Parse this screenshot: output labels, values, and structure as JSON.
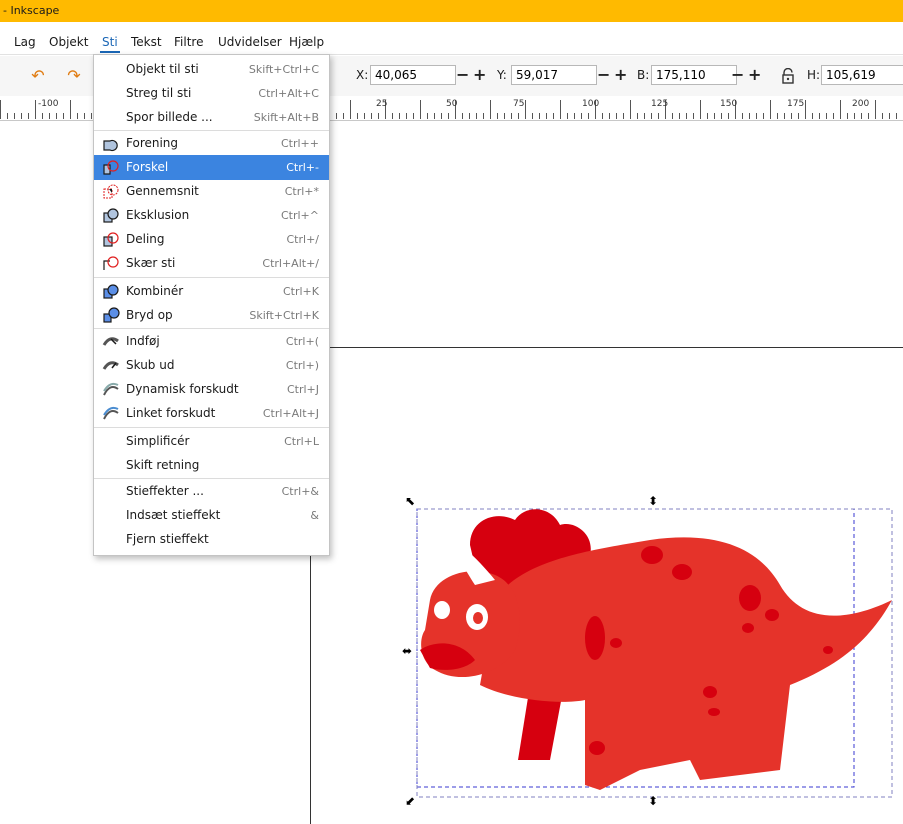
{
  "window": {
    "title": "- Inkscape"
  },
  "menubar": {
    "items": [
      {
        "label": "Lag"
      },
      {
        "label": "Objekt"
      },
      {
        "label": "Sti"
      },
      {
        "label": "Tekst"
      },
      {
        "label": "Filtre"
      },
      {
        "label": "Udvidelser"
      },
      {
        "label": "Hjælp"
      }
    ]
  },
  "toolbar": {
    "x_label": "X:",
    "x_value": "40,065",
    "y_label": "Y:",
    "y_value": "59,017",
    "w_label": "B:",
    "w_value": "175,110",
    "h_label": "H:",
    "h_value": "105,619",
    "minus": "−",
    "plus": "+"
  },
  "ruler": {
    "labels": [
      "-100",
      "25",
      "50",
      "75",
      "100",
      "125",
      "150",
      "175",
      "200"
    ]
  },
  "path_menu": {
    "items": [
      {
        "label": "Objekt til sti",
        "shortcut": "Skift+Ctrl+C",
        "icon": "none"
      },
      {
        "label": "Streg til sti",
        "shortcut": "Ctrl+Alt+C",
        "icon": "none"
      },
      {
        "label": "Spor billede ...",
        "shortcut": "Skift+Alt+B",
        "icon": "none"
      },
      {
        "label": "Forening",
        "shortcut": "Ctrl++",
        "icon": "union-icon"
      },
      {
        "label": "Forskel",
        "shortcut": "Ctrl+-",
        "icon": "difference-icon",
        "highlighted": true
      },
      {
        "label": "Gennemsnit",
        "shortcut": "Ctrl+*",
        "icon": "intersection-icon"
      },
      {
        "label": "Eksklusion",
        "shortcut": "Ctrl+^",
        "icon": "exclusion-icon"
      },
      {
        "label": "Deling",
        "shortcut": "Ctrl+/",
        "icon": "division-icon"
      },
      {
        "label": "Skær sti",
        "shortcut": "Ctrl+Alt+/",
        "icon": "cut-path-icon"
      },
      {
        "label": "Kombinér",
        "shortcut": "Ctrl+K",
        "icon": "combine-icon"
      },
      {
        "label": "Bryd op",
        "shortcut": "Skift+Ctrl+K",
        "icon": "break-apart-icon"
      },
      {
        "label": "Indføj",
        "shortcut": "Ctrl+(",
        "icon": "inset-icon"
      },
      {
        "label": "Skub ud",
        "shortcut": "Ctrl+)",
        "icon": "outset-icon"
      },
      {
        "label": "Dynamisk forskudt",
        "shortcut": "Ctrl+J",
        "icon": "dynamic-offset-icon"
      },
      {
        "label": "Linket forskudt",
        "shortcut": "Ctrl+Alt+J",
        "icon": "linked-offset-icon"
      },
      {
        "label": "Simplificér",
        "shortcut": "Ctrl+L",
        "icon": "none"
      },
      {
        "label": "Skift retning",
        "shortcut": "",
        "icon": "none"
      },
      {
        "label": "Stieffekter ...",
        "shortcut": "Ctrl+&",
        "icon": "none"
      },
      {
        "label": "Indsæt stieffekt",
        "shortcut": "&",
        "icon": "none"
      },
      {
        "label": "Fjern stieffekt",
        "shortcut": "",
        "icon": "none"
      }
    ]
  },
  "colors": {
    "titlebar": "#ffba00",
    "highlight": "#3b84e0",
    "dino_light": "#e5332a",
    "dino_dark": "#d6000f"
  }
}
